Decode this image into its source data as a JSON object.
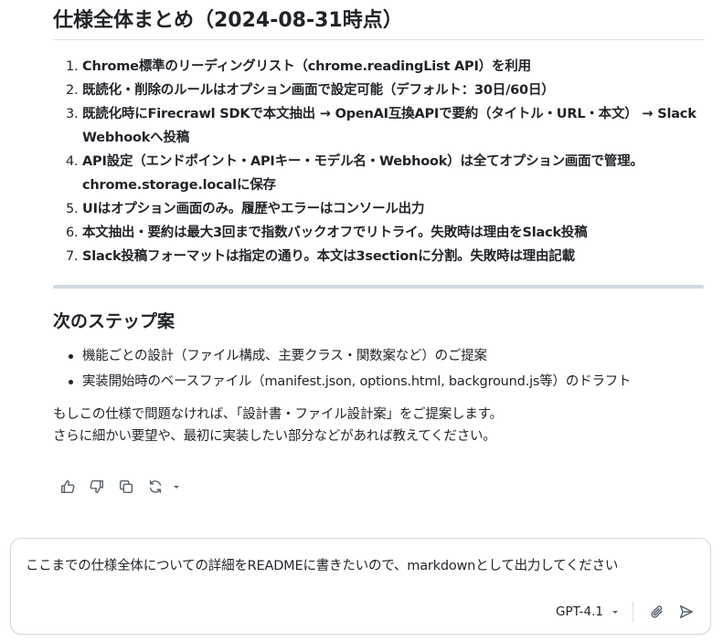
{
  "summary": {
    "title": "仕様全体まとめ（2024-08-31時点）",
    "items": [
      "Chrome標準のリーディングリスト（chrome.readingList API）を利用",
      "既読化・削除のルールはオプション画面で設定可能（デフォルト：30日/60日）",
      "既読化時にFirecrawl SDKで本文抽出 → OpenAI互換APIで要約（タイトル・URL・本文） → Slack Webhookへ投稿",
      "API設定（エンドポイント・APIキー・モデル名・Webhook）は全てオプション画面で管理。chrome.storage.localに保存",
      "UIはオプション画面のみ。履歴やエラーはコンソール出力",
      "本文抽出・要約は最大3回まで指数バックオフでリトライ。失敗時は理由をSlack投稿",
      "Slack投稿フォーマットは指定の通り。本文は3sectionに分割。失敗時は理由記載"
    ]
  },
  "next_steps": {
    "title": "次のステップ案",
    "items": [
      "機能ごとの設計（ファイル構成、主要クラス・関数案など）のご提案",
      "実装開始時のベースファイル（manifest.json, options.html, background.js等）のドラフト"
    ]
  },
  "closing": {
    "line1": "もしこの仕様で問題なければ、「設計書・ファイル設計案」をご提案します。",
    "line2": "さらに細かい要望や、最初に実装したい部分などがあれば教えてください。"
  },
  "actions": {
    "icons": [
      "thumbs-up-icon",
      "thumbs-down-icon",
      "copy-icon",
      "retry-icon",
      "chevron-down-icon"
    ]
  },
  "composer": {
    "value": "ここまでの仕様全体についての詳細をREADMEに書きたいので、markdownとして出力してください",
    "model": "GPT-4.1"
  },
  "colors": {
    "text": "#1f2328",
    "icon": "#59636e",
    "border": "#d0d7de",
    "separator": "#d1d9e0"
  }
}
